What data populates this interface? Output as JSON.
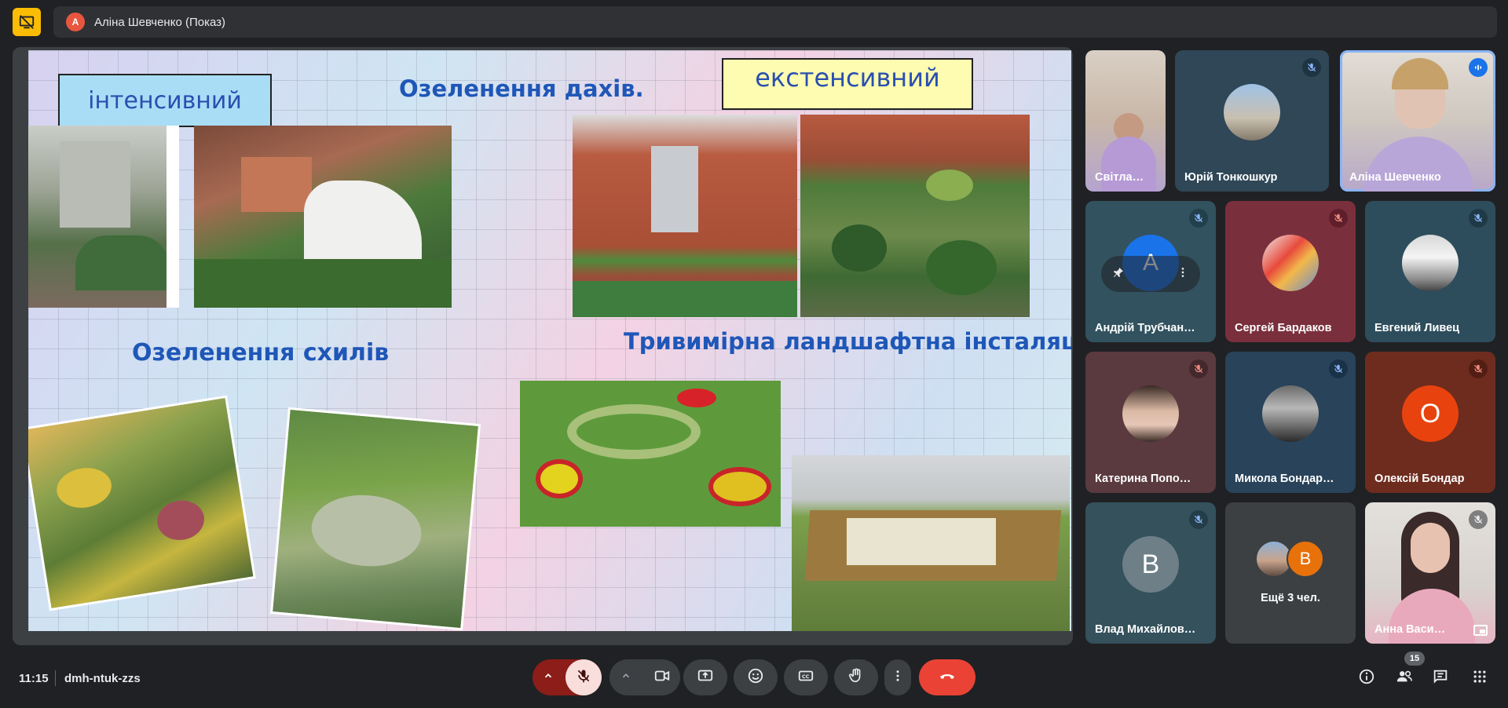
{
  "presenter": {
    "avatar_letter": "А",
    "title": "Аліна Шевченко (Показ)"
  },
  "slide": {
    "box_intensive": "інтенсивний",
    "box_extensive": "екстенсивний",
    "heading_roofs": "Озеленення дахів.",
    "heading_slopes": "Озеленення схилів",
    "heading_3d": "Тривимірна ландшафтна інсталяція"
  },
  "participants": [
    {
      "name": "Світла…",
      "mic": "off-hidden"
    },
    {
      "name": "Юрій Тонкошкур",
      "mic": "off"
    },
    {
      "name": "Аліна Шевченко",
      "mic": "speaking"
    },
    {
      "name": "Андрій Трубчан…",
      "mic": "off",
      "letter": "А"
    },
    {
      "name": "Сергей Бардаков",
      "mic": "off"
    },
    {
      "name": "Евгений Ливец",
      "mic": "off"
    },
    {
      "name": "Катерина Попо…",
      "mic": "off"
    },
    {
      "name": "Микола Бондар…",
      "mic": "off"
    },
    {
      "name": "Олексій Бондар",
      "mic": "off",
      "letter": "О"
    },
    {
      "name": "Влад Михайлов…",
      "mic": "off",
      "letter": "В"
    },
    {
      "name": "Ещё 3 чел.",
      "letter": "В"
    },
    {
      "name": "Анна Васи…",
      "mic": "off"
    }
  ],
  "footer": {
    "time": "11:15",
    "meeting_code": "dmh-ntuk-zzs",
    "people_count": "15"
  },
  "colors": {
    "end_call": "#ea4335",
    "mic_muted_bg": "#f9dedc",
    "presenting_yellow": "#fbbc04"
  }
}
